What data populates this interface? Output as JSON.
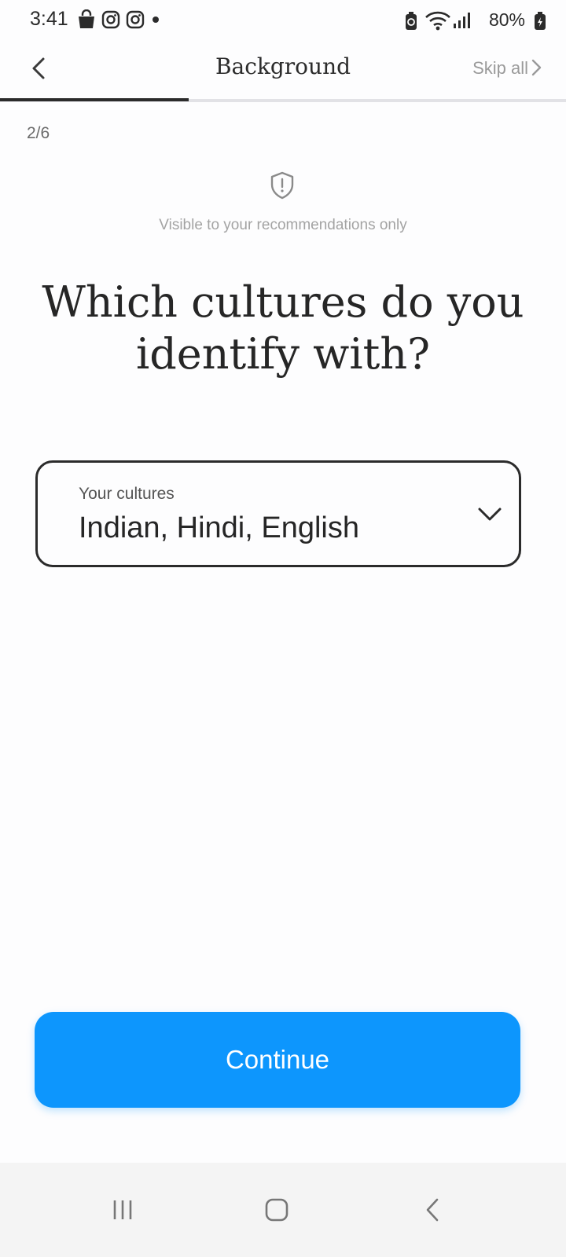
{
  "status_bar": {
    "time": "3:41",
    "battery": "80%",
    "left_icons": [
      "shopping-bag-icon",
      "instagram-icon",
      "instagram-icon",
      "notification-dot-icon"
    ],
    "right_icons": [
      "battery-saver-icon",
      "wifi-icon",
      "signal-icon",
      "battery-charging-icon"
    ]
  },
  "header": {
    "title": "Background",
    "skip_label": "Skip all",
    "progress_fraction": 0.333
  },
  "step": {
    "counter": "2/6"
  },
  "privacy": {
    "note": "Visible to your recommendations only",
    "icon": "shield-alert-icon"
  },
  "question": {
    "line1": "Which cultures do you",
    "line2": "identify with?"
  },
  "cultures_field": {
    "label": "Your cultures",
    "value": "Indian, Hindi, English"
  },
  "actions": {
    "continue_label": "Continue"
  },
  "colors": {
    "accent": "#0d96fd",
    "text": "#2b2b2b",
    "muted": "#9a9a9a",
    "background": "#fdfdfe"
  },
  "system_nav": {
    "buttons": [
      "recent-apps-icon",
      "home-icon",
      "back-icon"
    ]
  }
}
